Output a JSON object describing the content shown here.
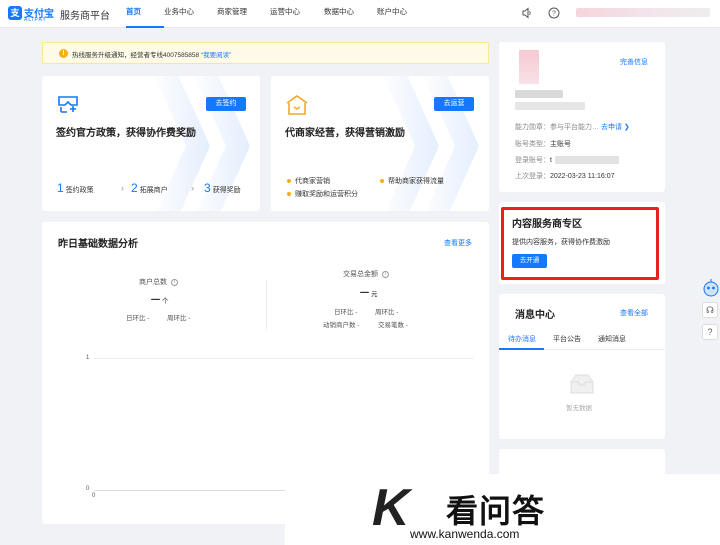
{
  "brand": {
    "logo_glyph": "支",
    "name_cn": "支付宝",
    "name_en": "ALIPAY",
    "platform": "服务商平台",
    "color": "#1677ff"
  },
  "nav": [
    {
      "label": "首页",
      "active": true
    },
    {
      "label": "业务中心"
    },
    {
      "label": "商家管理"
    },
    {
      "label": "运营中心"
    },
    {
      "label": "数据中心"
    },
    {
      "label": "账户中心"
    }
  ],
  "topbar_icons": [
    "speaker-icon",
    "help-icon"
  ],
  "notice": {
    "text": "热线服务升级通知，经营者专线4007585858",
    "link": "“我要阅读”"
  },
  "sign_card": {
    "button": "去签约",
    "title": "签约官方政策，获得协作费奖励",
    "steps": [
      {
        "num": "1",
        "label": "签约政策"
      },
      {
        "num": "2",
        "label": "拓展商户"
      },
      {
        "num": "3",
        "label": "获得奖励"
      }
    ]
  },
  "agent_card": {
    "button": "去运营",
    "title": "代商家经营，获得营销激励",
    "points": [
      "代商家营销",
      "帮助商家获得流量",
      "赚取奖励和运营积分"
    ]
  },
  "stats": {
    "title": "昨日基础数据分析",
    "more": "查看更多",
    "merchants_label": "商户总数",
    "merchants_value": "一",
    "merchants_unit": "个",
    "merchants_dod": "日环比 -",
    "merchants_wow": "周环比 -",
    "amount_label": "交易总金额",
    "amount_value": "一",
    "amount_unit": "元",
    "amount_dod": "日环比 -",
    "amount_wow": "周环比 -",
    "active_label": "动销商户数 -",
    "count_label": "交易笔数 -",
    "y_top": "1",
    "y_zero": "0",
    "x_zero": "0"
  },
  "profile": {
    "complete_link": "完善信息",
    "ability_key": "能力勋章：",
    "ability_val": "参与平台能力…",
    "ability_link": "去申请 ❯",
    "account_type_key": "账号类型：",
    "account_type_val": "主账号",
    "login_key": "登录账号：",
    "login_val": "t",
    "last_login_key": "上次登录：",
    "last_login_val": "2022-03-23 11:16:07"
  },
  "content_zone": {
    "title": "内容服务商专区",
    "desc": "提供内容服务，获得协作费激励",
    "button": "去开通",
    "highlight_color": "#e8211d"
  },
  "messages": {
    "title": "消息中心",
    "all": "查看全部",
    "tabs": [
      "待办消息",
      "平台公告",
      "通知消息"
    ],
    "empty": "暂无数据"
  },
  "watermark": {
    "logo_char": "K",
    "text": "看问答",
    "url": "www.kanwenda.com"
  }
}
